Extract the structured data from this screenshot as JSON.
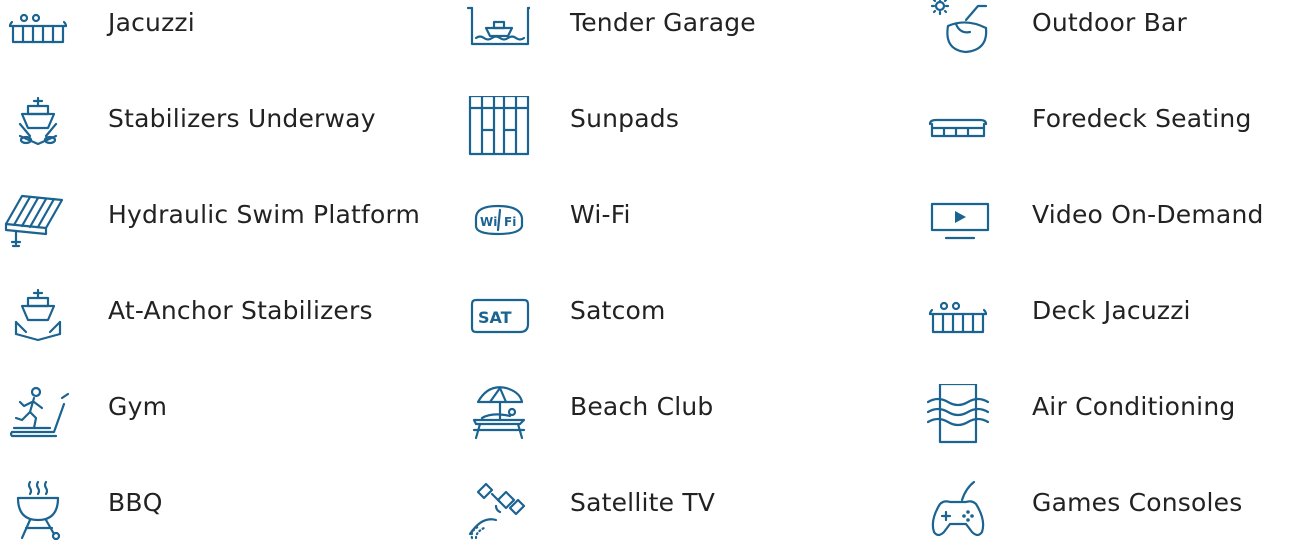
{
  "accent_color": "#1b6391",
  "text_color": "#222222",
  "amenities": {
    "col1": [
      {
        "label": "Jacuzzi",
        "icon": "jacuzzi-icon"
      },
      {
        "label": "Stabilizers Underway",
        "icon": "stabilizers-underway-icon"
      },
      {
        "label": "Hydraulic Swim Platform",
        "icon": "swim-platform-icon"
      },
      {
        "label": "At-Anchor Stabilizers",
        "icon": "at-anchor-stabilizers-icon"
      },
      {
        "label": "Gym",
        "icon": "gym-icon"
      },
      {
        "label": "BBQ",
        "icon": "bbq-icon"
      }
    ],
    "col2": [
      {
        "label": "Tender Garage",
        "icon": "tender-garage-icon"
      },
      {
        "label": "Sunpads",
        "icon": "sunpads-icon"
      },
      {
        "label": "Wi-Fi",
        "icon": "wifi-icon",
        "icon_text_left": "Wi",
        "icon_text_right": "Fi"
      },
      {
        "label": "Satcom",
        "icon": "satcom-icon",
        "icon_text": "SAT"
      },
      {
        "label": "Beach Club",
        "icon": "beach-club-icon"
      },
      {
        "label": "Satellite TV",
        "icon": "satellite-tv-icon"
      }
    ],
    "col3": [
      {
        "label": "Outdoor Bar",
        "icon": "outdoor-bar-icon"
      },
      {
        "label": "Foredeck Seating",
        "icon": "foredeck-seating-icon"
      },
      {
        "label": "Video On-Demand",
        "icon": "video-on-demand-icon"
      },
      {
        "label": "Deck Jacuzzi",
        "icon": "deck-jacuzzi-icon"
      },
      {
        "label": "Air Conditioning",
        "icon": "air-conditioning-icon"
      },
      {
        "label": "Games Consoles",
        "icon": "games-consoles-icon"
      }
    ]
  }
}
